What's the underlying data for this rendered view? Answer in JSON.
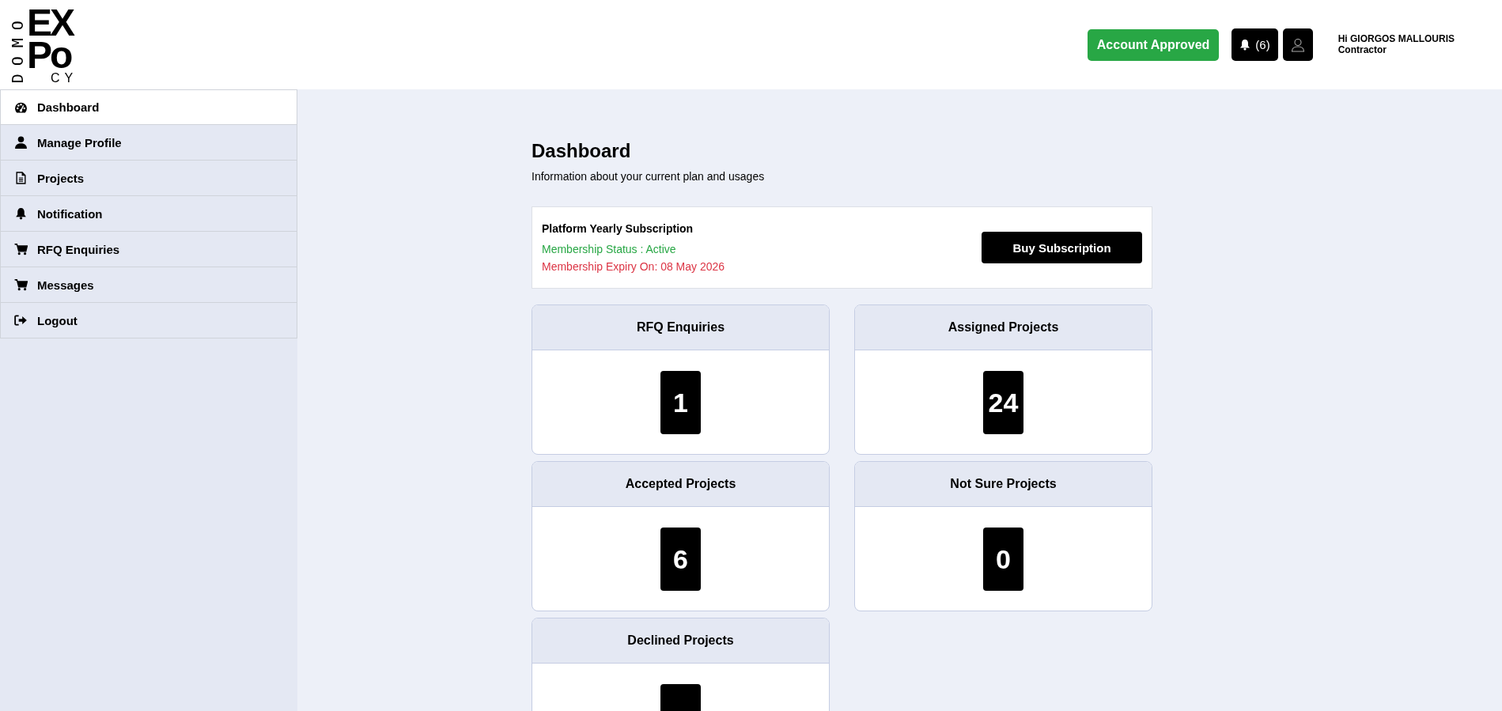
{
  "logo": {
    "vertical": "DOMO",
    "line1": "EX",
    "line2": "Po",
    "line3": "CY"
  },
  "header": {
    "status_button": "Account Approved",
    "notifications": "(6)",
    "greeting": "Hi GIORGOS MALLOURIS",
    "role": "Contractor"
  },
  "sidebar": {
    "items": [
      {
        "label": "Dashboard",
        "selected": true
      },
      {
        "label": "Manage Profile",
        "selected": false
      },
      {
        "label": "Projects",
        "selected": false
      },
      {
        "label": "Notification",
        "selected": false
      },
      {
        "label": "RFQ Enquiries",
        "selected": false
      },
      {
        "label": "Messages",
        "selected": false
      },
      {
        "label": "Logout",
        "selected": false
      }
    ]
  },
  "page": {
    "title": "Dashboard",
    "subtitle": "Information about your current plan and usages"
  },
  "subscription": {
    "plan": "Platform Yearly Subscription",
    "status": "Membership Status : Active",
    "expiry": "Membership Expiry On: 08 May 2026",
    "button": "Buy Subscription"
  },
  "stats": [
    {
      "title": "RFQ Enquiries",
      "value": "1"
    },
    {
      "title": "Assigned Projects",
      "value": "24"
    },
    {
      "title": "Accepted Projects",
      "value": "6"
    },
    {
      "title": "Not Sure Projects",
      "value": "0"
    },
    {
      "title": "Declined Projects"
    }
  ]
}
